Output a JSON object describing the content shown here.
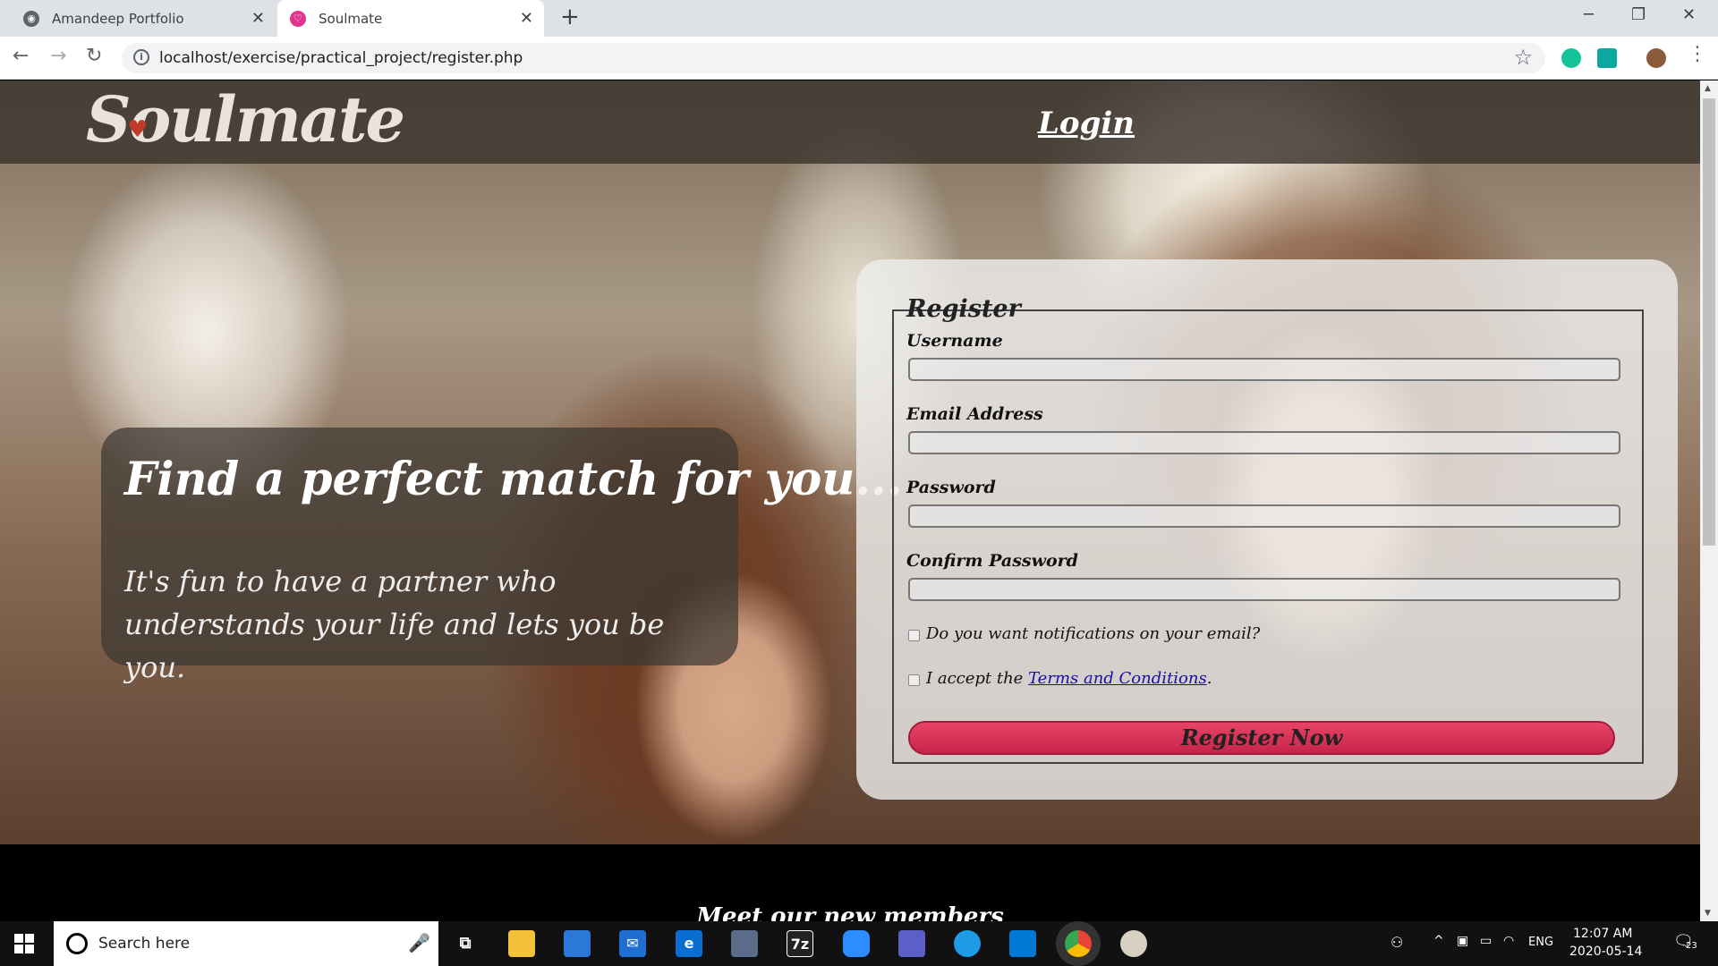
{
  "browser": {
    "tabs": [
      {
        "title": "Amandeep Portfolio"
      },
      {
        "title": "Soulmate"
      }
    ],
    "url": "localhost/exercise/practical_project/register.php"
  },
  "site": {
    "logo": "Soulmate",
    "login_link": "Login",
    "tagline_title": "Find a perfect match for you...",
    "tagline_sub": "It's fun to have a partner who understands your life and lets you be you.",
    "members_title": "Meet our new members"
  },
  "register": {
    "legend": "Register",
    "username_label": "Username",
    "email_label": "Email Address",
    "password_label": "Password",
    "confirm_label": "Confirm Password",
    "notify_label": "Do you want notifications on your email?",
    "terms_prefix": "I accept the",
    "terms_link": "Terms and Conditions",
    "terms_suffix": ".",
    "submit": "Register Now"
  },
  "taskbar": {
    "search_placeholder": "Search here",
    "lang": "ENG",
    "time": "12:07 AM",
    "date": "2020-05-14",
    "notifications": "23",
    "app_7z": "7z"
  },
  "colors": {
    "accent": "#d42d54",
    "link": "#1a0dab"
  }
}
